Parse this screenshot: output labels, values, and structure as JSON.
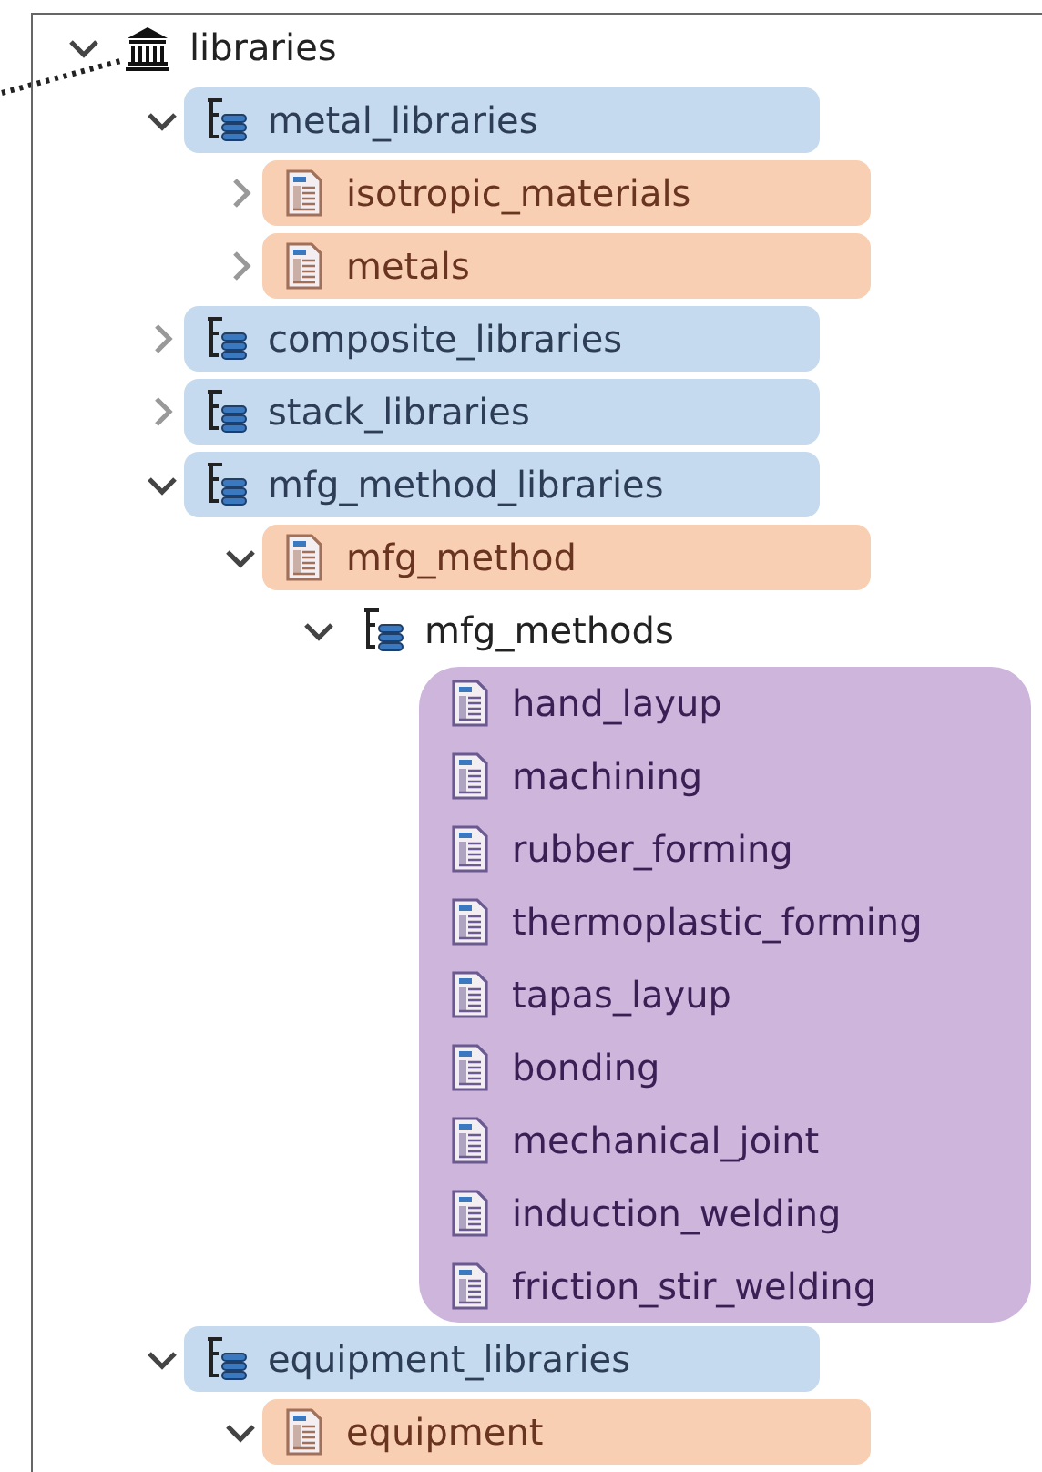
{
  "tree": {
    "label": "libraries",
    "kind": "root",
    "expanded": true,
    "children": [
      {
        "label": "metal_libraries",
        "kind": "library",
        "expanded": true,
        "color": "#c5daee",
        "children": [
          {
            "label": "isotropic_materials",
            "kind": "document",
            "expanded": false,
            "color": "#f9cfb3"
          },
          {
            "label": "metals",
            "kind": "document",
            "expanded": false,
            "color": "#f9cfb3"
          }
        ]
      },
      {
        "label": "composite_libraries",
        "kind": "library",
        "expanded": false,
        "color": "#c5daee"
      },
      {
        "label": "stack_libraries",
        "kind": "library",
        "expanded": false,
        "color": "#c5daee"
      },
      {
        "label": "mfg_method_libraries",
        "kind": "library",
        "expanded": true,
        "color": "#c5daee",
        "children": [
          {
            "label": "mfg_method",
            "kind": "document",
            "expanded": true,
            "color": "#f9cfb3",
            "children": [
              {
                "label": "mfg_methods",
                "kind": "library",
                "expanded": true,
                "children": [
                  {
                    "label": "hand_layup",
                    "kind": "document",
                    "color": "#cdb5dc"
                  },
                  {
                    "label": "machining",
                    "kind": "document",
                    "color": "#cdb5dc"
                  },
                  {
                    "label": "rubber_forming",
                    "kind": "document",
                    "color": "#cdb5dc"
                  },
                  {
                    "label": "thermoplastic_forming",
                    "kind": "document",
                    "color": "#cdb5dc"
                  },
                  {
                    "label": "tapas_layup",
                    "kind": "document",
                    "color": "#cdb5dc"
                  },
                  {
                    "label": "bonding",
                    "kind": "document",
                    "color": "#cdb5dc"
                  },
                  {
                    "label": "mechanical_joint",
                    "kind": "document",
                    "color": "#cdb5dc"
                  },
                  {
                    "label": "induction_welding",
                    "kind": "document",
                    "color": "#cdb5dc"
                  },
                  {
                    "label": "friction_stir_welding",
                    "kind": "document",
                    "color": "#cdb5dc"
                  }
                ]
              }
            ]
          }
        ]
      },
      {
        "label": "equipment_libraries",
        "kind": "library",
        "expanded": true,
        "color": "#c5daee",
        "children": [
          {
            "label": "equipment",
            "kind": "document",
            "expanded": true,
            "color": "#f9cfb3"
          }
        ]
      }
    ]
  }
}
